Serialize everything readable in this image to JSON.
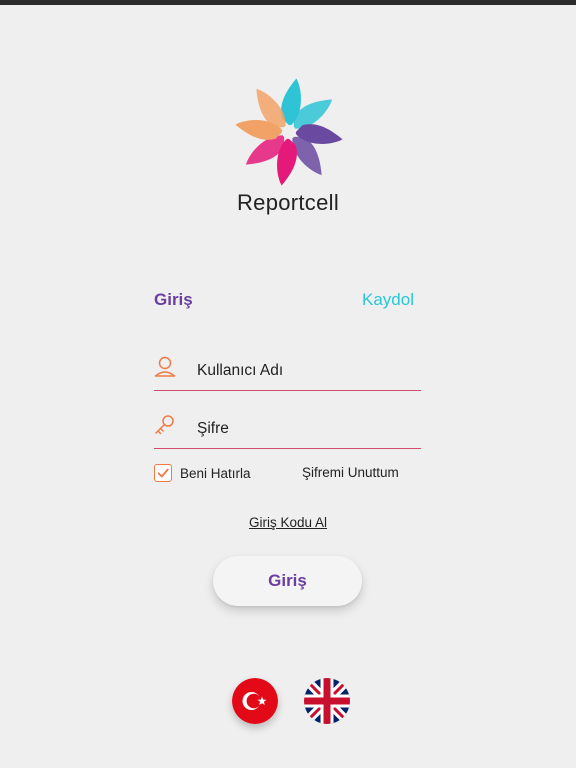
{
  "app": {
    "brand_name": "Reportcell",
    "logo_colors": [
      "#2ec4d6",
      "#6a4aa0",
      "#e5197a",
      "#f2a266"
    ]
  },
  "tabs": {
    "login_label": "Giriş",
    "register_label": "Kaydol",
    "active_color": "#6a3fa0",
    "inactive_color": "#29c7d3"
  },
  "form": {
    "username": {
      "placeholder": "Kullanıcı Adı",
      "icon": "user-icon"
    },
    "password": {
      "placeholder": "Şifre",
      "icon": "key-icon"
    },
    "remember_me": {
      "label": "Beni Hatırla",
      "checked": true
    },
    "forgot_password_label": "Şifremi Unuttum",
    "get_code_label": "Giriş Kodu Al",
    "submit_label": "Giriş"
  },
  "languages": [
    {
      "name": "Türkçe",
      "icon": "turkey-flag-icon",
      "selected": true
    },
    {
      "name": "English",
      "icon": "uk-flag-icon",
      "selected": false
    }
  ]
}
